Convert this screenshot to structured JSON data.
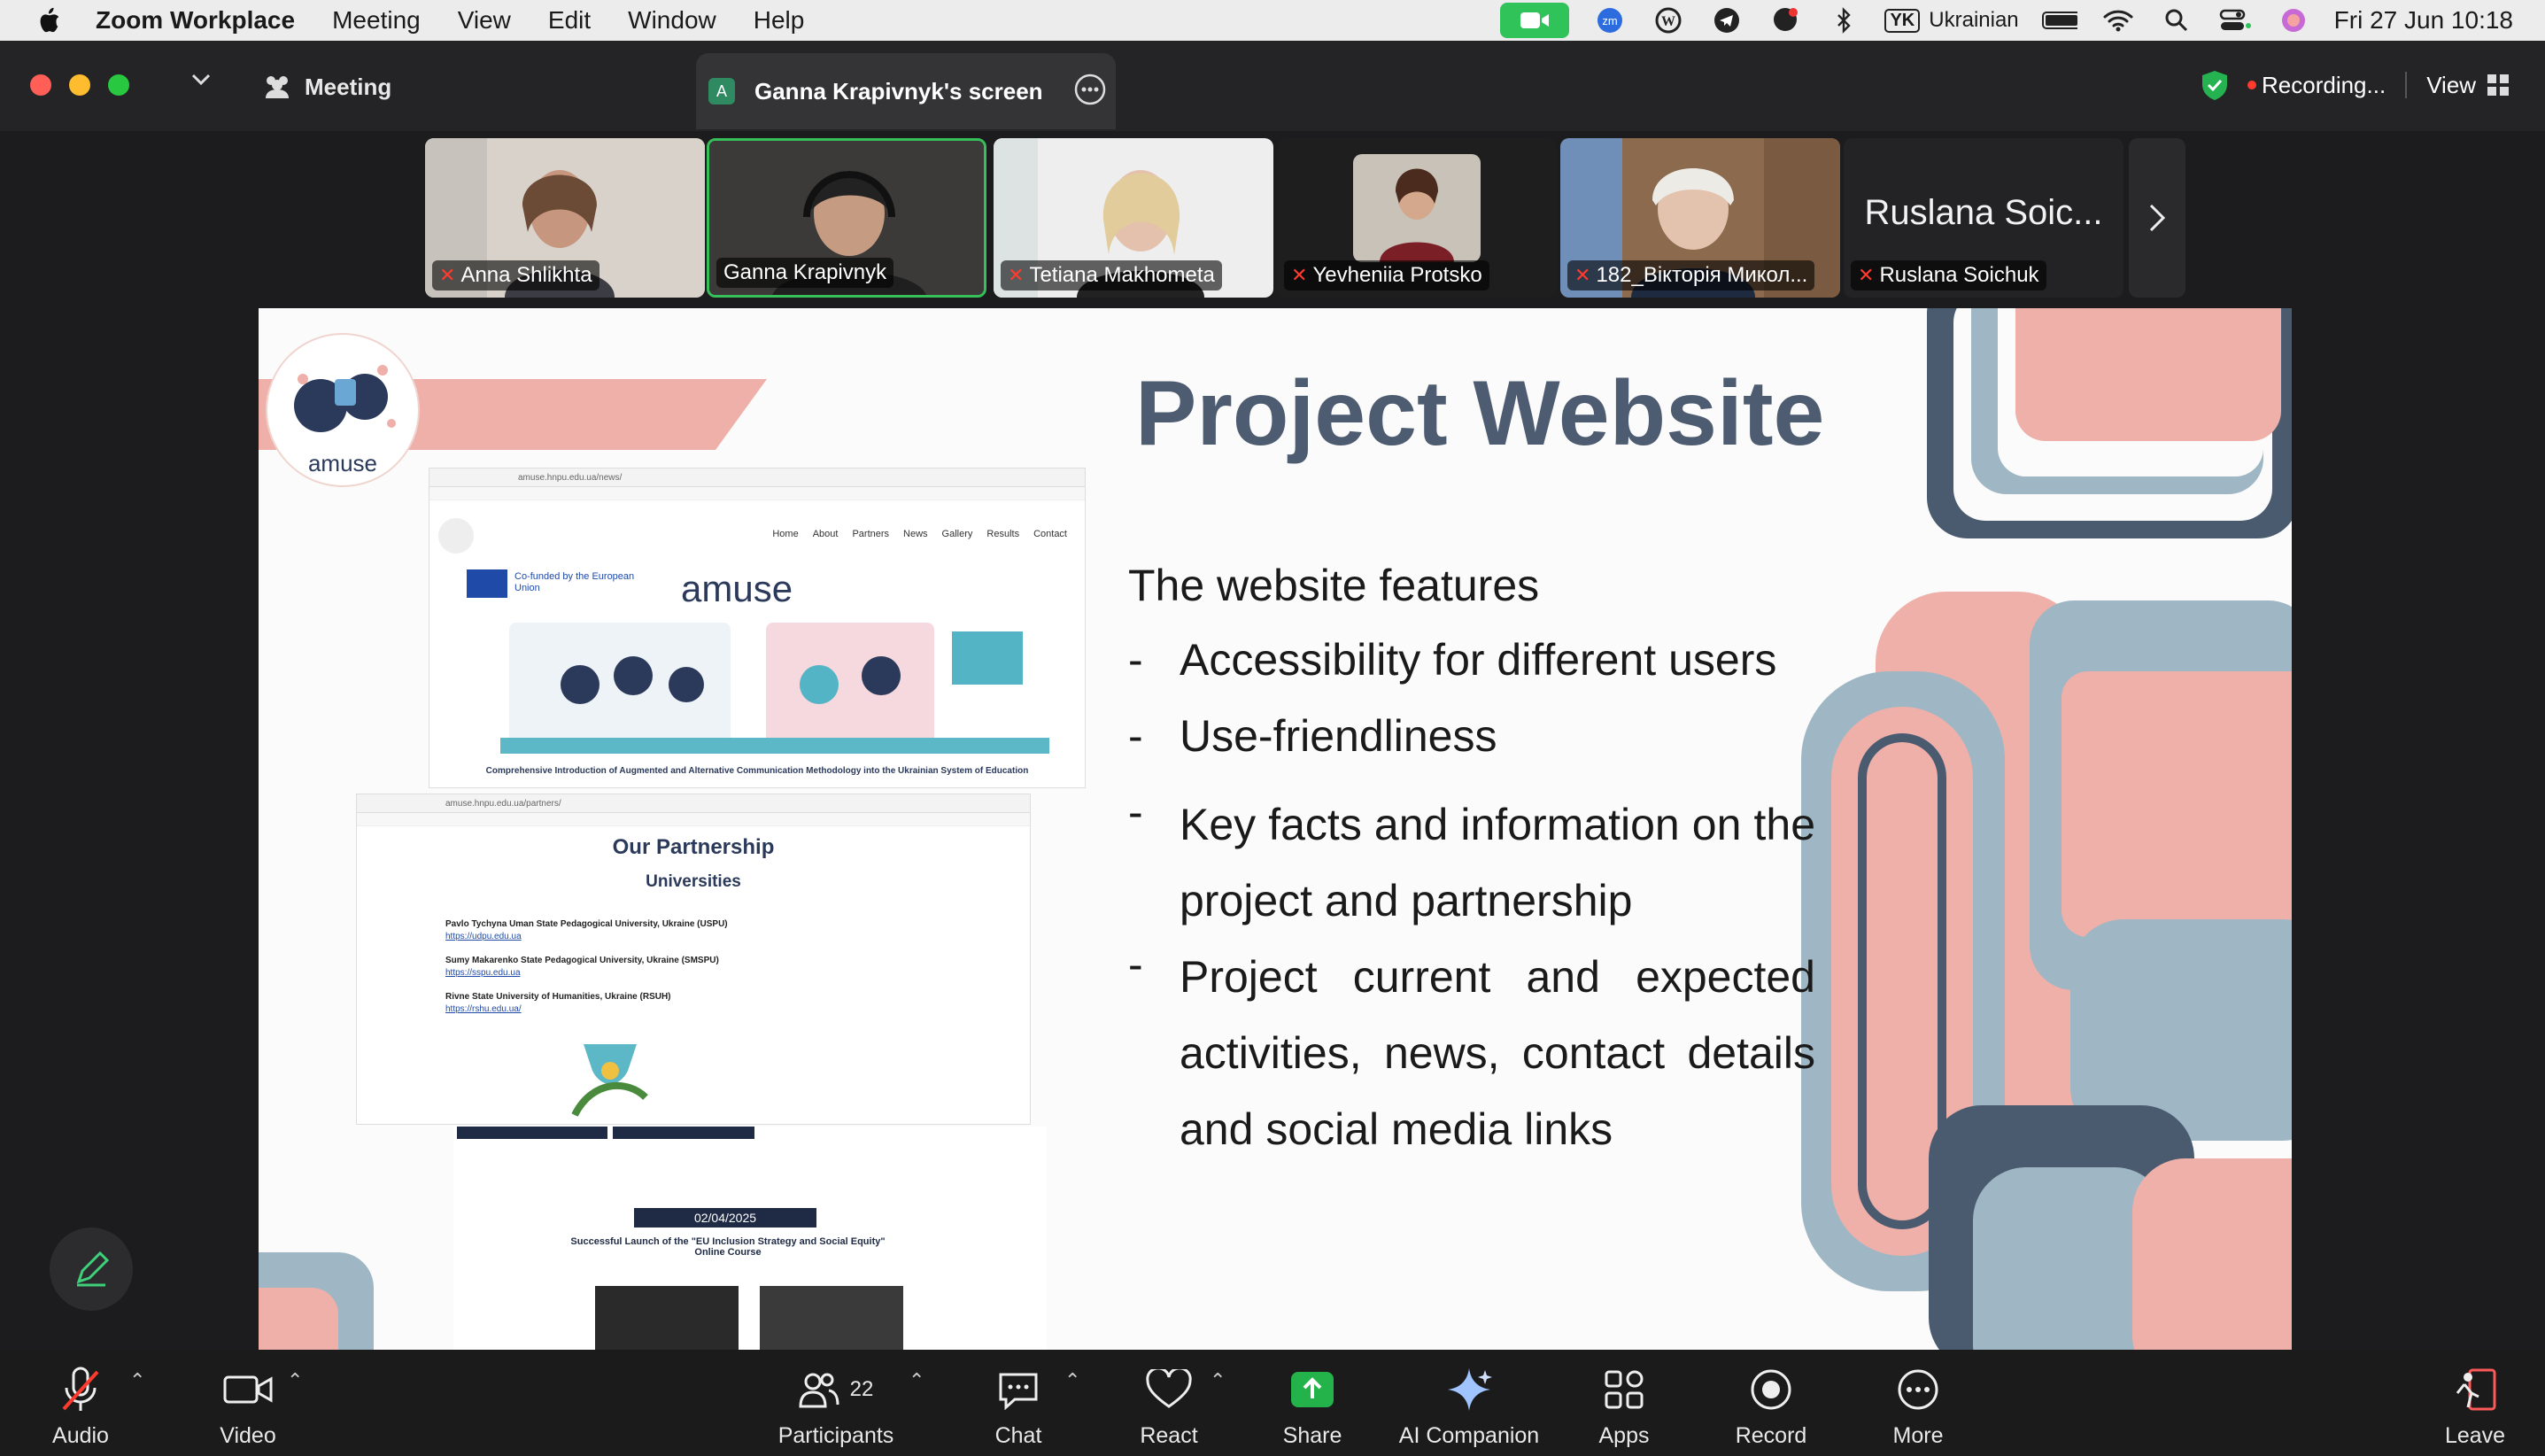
{
  "menubar": {
    "app_name": "Zoom Workplace",
    "menus": [
      "Meeting",
      "View",
      "Edit",
      "Window",
      "Help"
    ],
    "keyboard_layout_badge": "YK",
    "keyboard_layout": "Ukrainian",
    "datetime": "Fri 27 Jun  10:18"
  },
  "window": {
    "meeting_tab": "Meeting",
    "screen_tab": "Ganna Krapivnyk's screen",
    "screen_tab_avatar": "A",
    "recording": "Recording...",
    "view": "View"
  },
  "gallery": {
    "tiles": [
      {
        "name": "Anna Shlikhta"
      },
      {
        "name": "Ganna Krapivnyk"
      },
      {
        "name": "Tetiana Makhometa"
      },
      {
        "name": "Yevheniia Protsko"
      },
      {
        "name": "182_Вікторія Микол..."
      },
      {
        "name": "Ruslana Soichuk",
        "placeholder": "Ruslana Soic..."
      }
    ]
  },
  "slide": {
    "title": "Project Website",
    "intro": "The website features",
    "bullets": [
      "Accessibility for different users",
      "Use-friendliness",
      "Key facts and information on the project and partnership",
      "Project current and expected activities, news, contact details and social media links"
    ],
    "dash": "-",
    "logo_text": "amuse",
    "site": {
      "url1": "amuse.hnpu.edu.ua/news/",
      "nav": [
        "Home",
        "About",
        "Partners",
        "News",
        "Gallery",
        "Results",
        "Contact"
      ],
      "eu": "Co-funded by the European Union",
      "brand": "amuse",
      "hero_caption": "Comprehensive Introduction of Augmented and Alternative Communication Methodology into the Ukrainian System of Education",
      "url2": "amuse.hnpu.edu.ua/partners/",
      "partnership_title": "Our Partnership",
      "universities": "Universities",
      "unis": [
        {
          "name": "Pavlo Tychyna Uman State Pedagogical University, Ukraine (USPU)",
          "url": "https://udpu.edu.ua"
        },
        {
          "name": "Sumy Makarenko State Pedagogical University, Ukraine (SMSPU)",
          "url": "https://sspu.edu.ua"
        },
        {
          "name": "Rivne State University of Humanities, Ukraine (RSUH)",
          "url": "https://rshu.edu.ua/"
        }
      ],
      "news_date": "02/04/2025",
      "news_title": "Successful Launch of the \"EU Inclusion Strategy and Social Equity\" Online Course"
    }
  },
  "toolbar": {
    "audio": "Audio",
    "video": "Video",
    "participants": "Participants",
    "participants_count": "22",
    "chat": "Chat",
    "react": "React",
    "share": "Share",
    "ai_companion": "AI Companion",
    "apps": "Apps",
    "record": "Record",
    "more": "More",
    "leave": "Leave"
  },
  "colors": {
    "slide_title": "#4e5c72",
    "deco_pink": "#eeb0a8",
    "deco_blue": "#9fb7c4",
    "deco_navy": "#4a5b70",
    "zoom_green": "#2fc35a",
    "share_green": "#24b24b"
  }
}
